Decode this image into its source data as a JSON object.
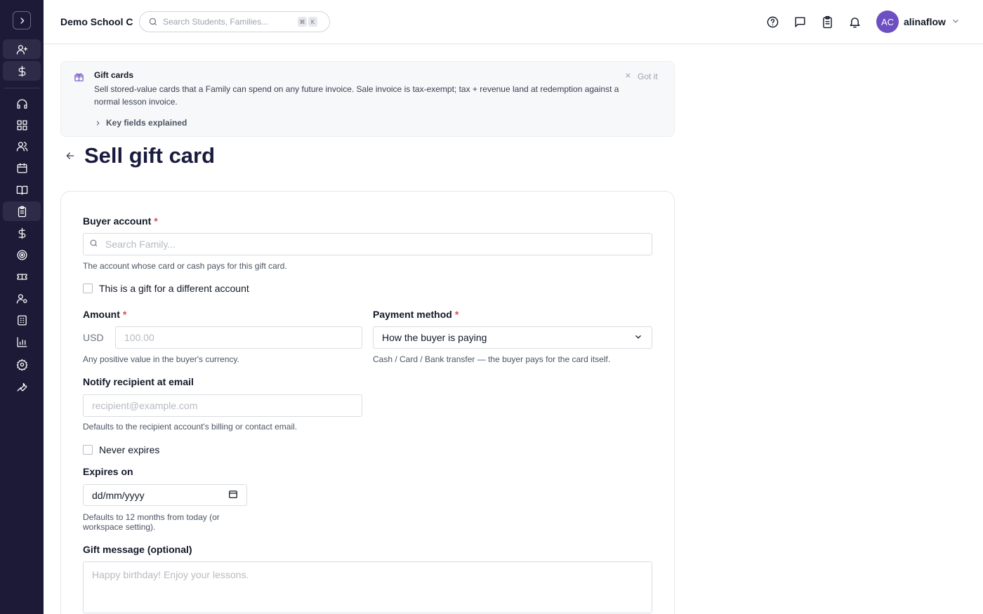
{
  "header": {
    "school_name": "Demo School C",
    "search_placeholder": "Search Students, Families...",
    "shortcut_key_1": "⌘",
    "shortcut_key_2": "K",
    "avatar_initials": "AC",
    "username": "alinaflow"
  },
  "banner": {
    "title": "Gift cards",
    "text": "Sell stored-value cards that a Family can spend on any future invoice. Sale invoice is tax-exempt; tax + revenue land at redemption against a normal lesson invoice.",
    "dismiss_label": "Got it",
    "key_fields_label": "Key fields explained"
  },
  "page": {
    "title": "Sell gift card"
  },
  "form": {
    "buyer_label": "Buyer account",
    "required_mark": "*",
    "buyer_placeholder": "Search Family...",
    "buyer_help": "The account whose card or cash pays for this gift card.",
    "gift_checkbox_label": "This is a gift for a different account",
    "amount_label": "Amount",
    "currency": "USD",
    "amount_placeholder": "100.00",
    "amount_help": "Any positive value in the buyer's currency.",
    "payment_label": "Payment method",
    "payment_value": "How the buyer is paying",
    "payment_help": "Cash / Card / Bank transfer — the buyer pays for the card itself.",
    "notify_label": "Notify recipient at email",
    "notify_placeholder": "recipient@example.com",
    "notify_help": "Defaults to the recipient account's billing or contact email.",
    "never_expires_label": "Never expires",
    "expires_label": "Expires on",
    "expires_value": "dd/mm/yyyy",
    "expires_help_line1": "Defaults to 12 months from today (or",
    "expires_help_line2": "workspace setting).",
    "message_label": "Gift message (optional)",
    "message_placeholder": "Happy birthday! Enjoy your lessons."
  },
  "sidebar_icons": [
    "chevron-right-icon",
    "user-plus-icon",
    "dollar-icon",
    "headset-icon",
    "dashboard-icon",
    "users-icon",
    "calendar-icon",
    "book-icon",
    "clipboard-icon",
    "dollar-icon",
    "target-icon",
    "ticket-icon",
    "user-settings-icon",
    "building-icon",
    "chart-icon",
    "gear-icon",
    "wrench-icon"
  ]
}
